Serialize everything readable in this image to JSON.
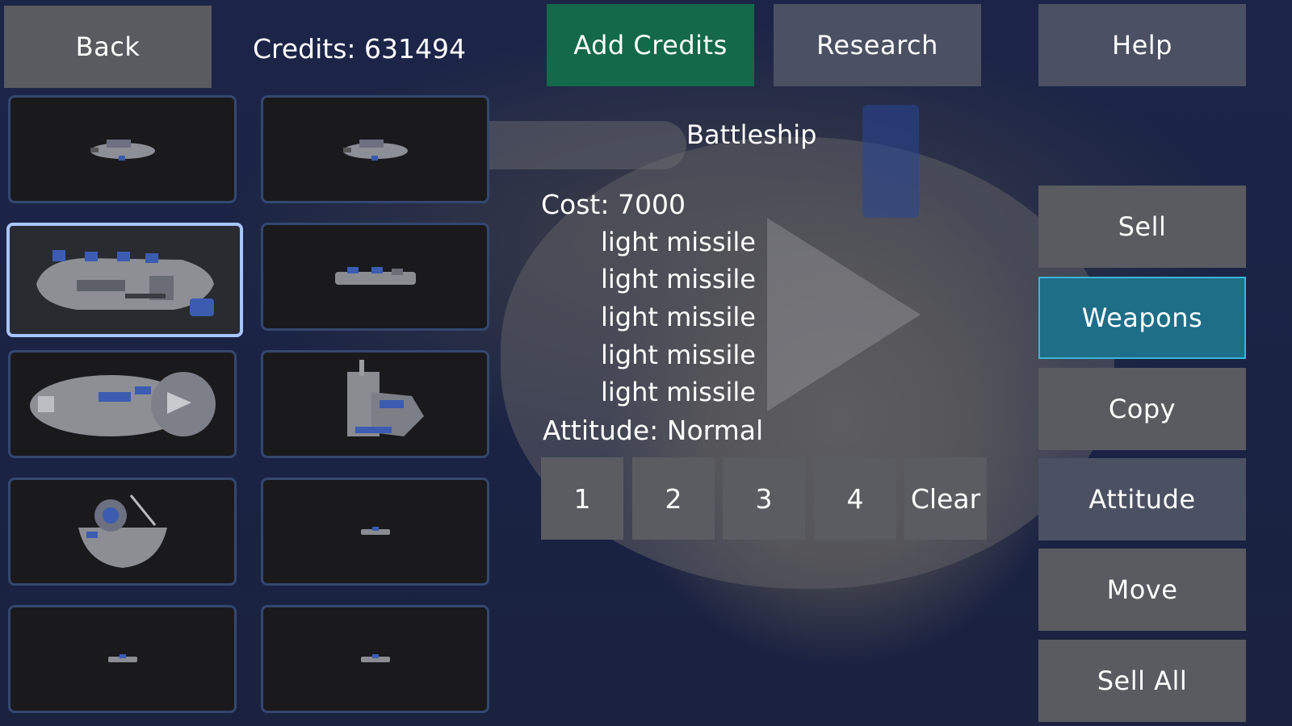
{
  "header": {
    "back_label": "Back",
    "credits_text": "Credits: 631494",
    "add_credits_label": "Add Credits",
    "research_label": "Research",
    "help_label": "Help"
  },
  "ship_grid": {
    "selected_index": 2,
    "tiles": [
      "ship-thumbnail-1",
      "ship-thumbnail-2",
      "ship-thumbnail-3",
      "ship-thumbnail-4",
      "ship-thumbnail-5",
      "ship-thumbnail-6",
      "ship-thumbnail-7",
      "ship-thumbnail-8",
      "ship-thumbnail-9",
      "ship-thumbnail-10"
    ]
  },
  "details": {
    "name": "Battleship",
    "cost": "Cost: 7000",
    "weapons": [
      "light missile",
      "light missile",
      "light missile",
      "light missile",
      "light missile"
    ],
    "attitude": "Attitude: Normal",
    "group_buttons": [
      "1",
      "2",
      "3",
      "4",
      "Clear"
    ]
  },
  "actions": {
    "sell": "Sell",
    "weapons": "Weapons",
    "copy": "Copy",
    "attitude": "Attitude",
    "move": "Move",
    "sell_all": "Sell All"
  },
  "colors": {
    "background": "#1c2548",
    "button": "#4b5163",
    "add_credits": "#13694a",
    "active_tab": "#1f6e88",
    "selected_tile_border": "#a9c5ff"
  }
}
